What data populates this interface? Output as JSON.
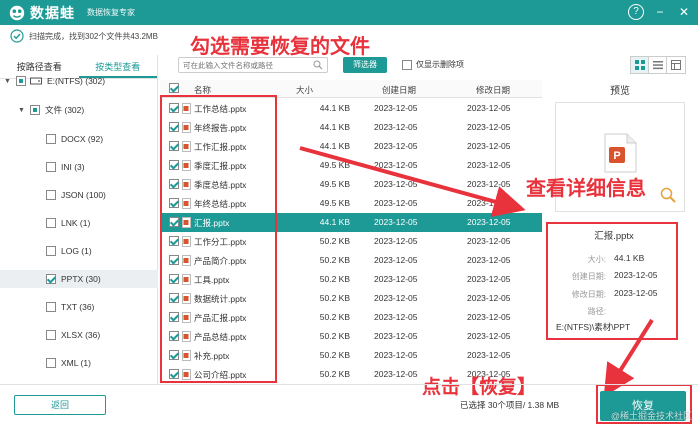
{
  "app": {
    "name": "数据蛙",
    "subtitle": "数据恢复专家",
    "help_glyph": "?",
    "minimize_glyph": "−",
    "close_glyph": "✕"
  },
  "status": {
    "text": "扫描完成，找到302个文件共43.2MB"
  },
  "sidebar": {
    "tabs": [
      "按路径查看",
      "按类型查看"
    ],
    "active_tab": 1,
    "tree": [
      {
        "label": "E:(NTFS) (302)",
        "level": 0,
        "checked": "partial"
      },
      {
        "label": "文件 (302)",
        "level": 1,
        "checked": "partial"
      },
      {
        "label": "DOCX (92)",
        "level": 2,
        "checked": "none"
      },
      {
        "label": "INI (3)",
        "level": 2,
        "checked": "none"
      },
      {
        "label": "JSON (100)",
        "level": 2,
        "checked": "none"
      },
      {
        "label": "LNK (1)",
        "level": 2,
        "checked": "none"
      },
      {
        "label": "LOG (1)",
        "level": 2,
        "checked": "none"
      },
      {
        "label": "PPTX (30)",
        "level": 2,
        "checked": "on",
        "selected": true
      },
      {
        "label": "TXT (36)",
        "level": 2,
        "checked": "none"
      },
      {
        "label": "XLSX (36)",
        "level": 2,
        "checked": "none"
      },
      {
        "label": "XML (1)",
        "level": 2,
        "checked": "none"
      }
    ]
  },
  "toolbar": {
    "search_placeholder": "可在此输入文件名称或路径",
    "filter_label": "筛选器",
    "only_deleted_label": "仅显示删除项"
  },
  "table": {
    "headers": {
      "name": "名称",
      "size": "大小",
      "created": "创建日期",
      "modified": "修改日期"
    },
    "rows": [
      {
        "name": "工作总结.pptx",
        "size": "44.1 KB",
        "created": "2023-12-05",
        "modified": "2023-12-05"
      },
      {
        "name": "年终报告.pptx",
        "size": "44.1 KB",
        "created": "2023-12-05",
        "modified": "2023-12-05"
      },
      {
        "name": "工作汇报.pptx",
        "size": "44.1 KB",
        "created": "2023-12-05",
        "modified": "2023-12-05"
      },
      {
        "name": "季度汇报.pptx",
        "size": "49.5 KB",
        "created": "2023-12-05",
        "modified": "2023-12-05"
      },
      {
        "name": "季度总结.pptx",
        "size": "49.5 KB",
        "created": "2023-12-05",
        "modified": "2023-12-05"
      },
      {
        "name": "年终总结.pptx",
        "size": "49.5 KB",
        "created": "2023-12-05",
        "modified": "2023-12-05"
      },
      {
        "name": "汇报.pptx",
        "size": "44.1 KB",
        "created": "2023-12-05",
        "modified": "2023-12-05",
        "selected": true
      },
      {
        "name": "工作分工.pptx",
        "size": "50.2 KB",
        "created": "2023-12-05",
        "modified": "2023-12-05"
      },
      {
        "name": "产品简介.pptx",
        "size": "50.2 KB",
        "created": "2023-12-05",
        "modified": "2023-12-05"
      },
      {
        "name": "工具.pptx",
        "size": "50.2 KB",
        "created": "2023-12-05",
        "modified": "2023-12-05"
      },
      {
        "name": "数据统计.pptx",
        "size": "50.2 KB",
        "created": "2023-12-05",
        "modified": "2023-12-05"
      },
      {
        "name": "产品汇报.pptx",
        "size": "50.2 KB",
        "created": "2023-12-05",
        "modified": "2023-12-05"
      },
      {
        "name": "产品总结.pptx",
        "size": "50.2 KB",
        "created": "2023-12-05",
        "modified": "2023-12-05"
      },
      {
        "name": "补充.pptx",
        "size": "50.2 KB",
        "created": "2023-12-05",
        "modified": "2023-12-05"
      },
      {
        "name": "公司介绍.pptx",
        "size": "50.2 KB",
        "created": "2023-12-05",
        "modified": "2023-12-05"
      }
    ]
  },
  "preview": {
    "title": "预览",
    "file_name": "汇报.pptx",
    "labels": {
      "size": "大小:",
      "created": "创建日期:",
      "modified": "修改日期:",
      "path": "路径:"
    },
    "values": {
      "size": "44.1 KB",
      "created": "2023-12-05",
      "modified": "2023-12-05",
      "path": "E:(NTFS)\\素材\\PPT"
    }
  },
  "annotations": {
    "select_files": "勾选需要恢复的文件",
    "view_details": "查看详细信息",
    "click_recover": "点击【恢复】",
    "color": "#e8323c"
  },
  "bottom": {
    "back_label": "返回",
    "selected_text": "已选择 30个项目/ 1.38 MB",
    "recover_label": "恢复",
    "watermark": "@稀土掘金技术社区"
  },
  "colors": {
    "accent": "#1e9a96",
    "annotation": "#e8323c"
  }
}
